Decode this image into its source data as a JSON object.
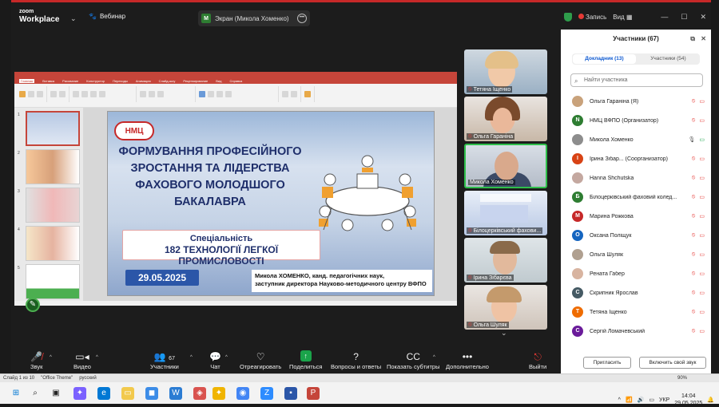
{
  "app": {
    "name_line1": "zoom",
    "name_line2": "Workplace",
    "meeting_type": "Вебинар"
  },
  "screen_share": {
    "label": "Экран (Микола Хоменко)",
    "initial": "M"
  },
  "top_right": {
    "record": "Запись",
    "view": "Вид"
  },
  "slide": {
    "logo_text": "НМЦ",
    "title_lines": [
      "ФОРМУВАННЯ ПРОФЕСІЙНОГО",
      "ЗРОСТАННЯ ТА ЛІДЕРСТВА",
      "ФАХОВОГО МОЛОДШОГО",
      "БАКАЛАВРА"
    ],
    "specialty_label": "Спеціальність",
    "specialty_value": "182 ТЕХНОЛОГІЇ ЛЕГКОЇ ПРОМИСЛОВОСТІ",
    "date": "29.05.2025",
    "author_line1": "Микола ХОМЕНКО, канд. педагогічних наук,",
    "author_line2": "заступник директора Науково-методичного центру ВФПО"
  },
  "videos": [
    {
      "name": "Тетяна Іщенко",
      "muted": true
    },
    {
      "name": "Ольга Гараніна",
      "muted": true
    },
    {
      "name": "Микола Хоменко",
      "muted": false,
      "speaking": true
    },
    {
      "name": "Білоцерківський фахови...",
      "muted": true
    },
    {
      "name": "Ірина Зібарєва",
      "muted": true
    },
    {
      "name": "Ольга Шуляк",
      "muted": true
    }
  ],
  "toolbar": {
    "audio": "Звук",
    "video": "Видео",
    "participants": "Участники",
    "participants_count": "67",
    "chat": "Чат",
    "react": "Отреагировать",
    "share": "Поделиться",
    "qa": "Вопросы и ответы",
    "captions": "Показать субтитры",
    "more": "Дополнительно",
    "leave": "Выйти"
  },
  "panel": {
    "title": "Участники (67)",
    "tab_panelists": "Докладник (13)",
    "tab_attendees": "Участники (54)",
    "search_placeholder": "Найти участника",
    "participants": [
      {
        "name": "Ольга Гараніна (Я)",
        "initial": "",
        "color": "#c9a27b"
      },
      {
        "name": "НМЦ ВФПО (Организатор)",
        "initial": "N",
        "color": "#2e7d32"
      },
      {
        "name": "Микола Хоменко",
        "initial": "",
        "color": "#8d8d8d"
      },
      {
        "name": "Ірина Зібар... (Соорганизатор)",
        "initial": "I",
        "color": "#d84315"
      },
      {
        "name": "Hanna Shchutska",
        "initial": "",
        "color": "#c4a8a0"
      },
      {
        "name": "Білоцерківський фаховий колед...",
        "initial": "Б",
        "color": "#2e7d32"
      },
      {
        "name": "Марина Рожкова",
        "initial": "М",
        "color": "#c62828"
      },
      {
        "name": "Оксана Поліщук",
        "initial": "О",
        "color": "#1565c0"
      },
      {
        "name": "Ольга Шуляк",
        "initial": "",
        "color": "#b0a090"
      },
      {
        "name": "Рената Габер",
        "initial": "",
        "color": "#d8b4a0"
      },
      {
        "name": "Скрипник Ярослав",
        "initial": "С",
        "color": "#455a64"
      },
      {
        "name": "Тетяна Іщенко",
        "initial": "Т",
        "color": "#ef6c00"
      },
      {
        "name": "Сергій Ломачевський",
        "initial": "С",
        "color": "#6a1b9a"
      }
    ],
    "invite_button": "Пригласить",
    "enable_audio_button": "Включить свой звук"
  },
  "ppt_status": {
    "slide_of": "Слайд 1 из 10",
    "theme": "\"Office Theme\"",
    "lang": "русский"
  },
  "system": {
    "lang": "УКР",
    "time": "14:04",
    "date": "29.05.2025",
    "zoom": "90%"
  }
}
